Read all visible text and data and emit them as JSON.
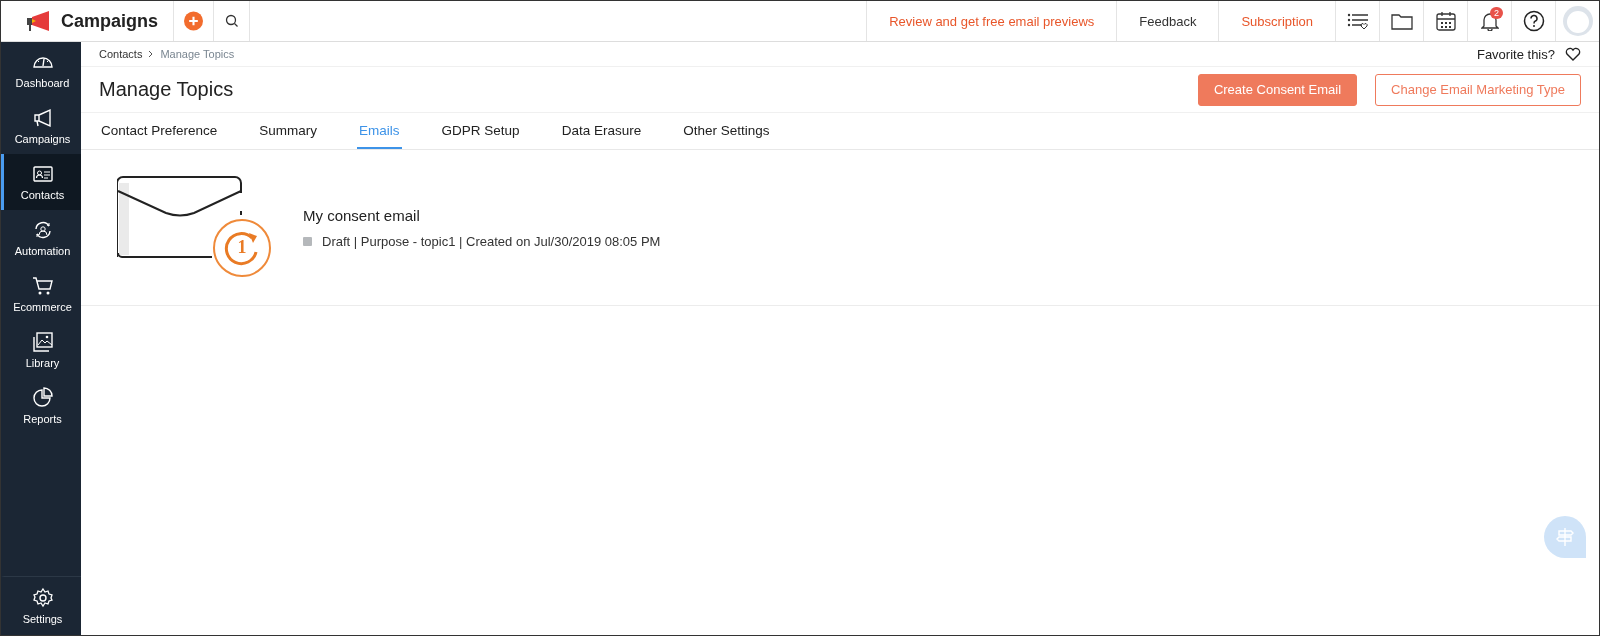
{
  "app": {
    "name": "Campaigns"
  },
  "topbar": {
    "links": [
      {
        "label": "Review and get free email previews",
        "kind": "promo"
      },
      {
        "label": "Feedback",
        "kind": "plain"
      },
      {
        "label": "Subscription",
        "kind": "promo"
      }
    ],
    "notification_count": "2"
  },
  "sidebar": {
    "items": [
      {
        "label": "Dashboard",
        "kind": "dashboard",
        "selected": false
      },
      {
        "label": "Campaigns",
        "kind": "megaphone",
        "selected": false
      },
      {
        "label": "Contacts",
        "kind": "contact-card",
        "selected": true
      },
      {
        "label": "Automation",
        "kind": "automation",
        "selected": false
      },
      {
        "label": "Ecommerce",
        "kind": "cart",
        "selected": false
      },
      {
        "label": "Library",
        "kind": "image",
        "selected": false
      },
      {
        "label": "Reports",
        "kind": "pie",
        "selected": false
      }
    ],
    "footer": {
      "label": "Settings"
    }
  },
  "breadcrumb": [
    "Contacts",
    "Manage Topics"
  ],
  "favorite": {
    "label": "Favorite this?"
  },
  "title": "Manage Topics",
  "buttons": [
    {
      "label": "Create Consent Email",
      "kind": "primary"
    },
    {
      "label": "Change Email Marketing Type",
      "kind": "outline"
    }
  ],
  "tabs": [
    {
      "label": "Contact Preference",
      "selected": false
    },
    {
      "label": "Summary",
      "selected": false
    },
    {
      "label": "Emails",
      "selected": true
    },
    {
      "label": "GDPR Setup",
      "selected": false
    },
    {
      "label": "Data Erasure",
      "selected": false
    },
    {
      "label": "Other Settings",
      "selected": false
    }
  ],
  "emails": [
    {
      "name": "My consent email",
      "badge": "1",
      "color": "#b5b8bb",
      "details": "Draft | Purpose - topic1 | Created on Jul/30/2019 08:05 PM"
    }
  ]
}
